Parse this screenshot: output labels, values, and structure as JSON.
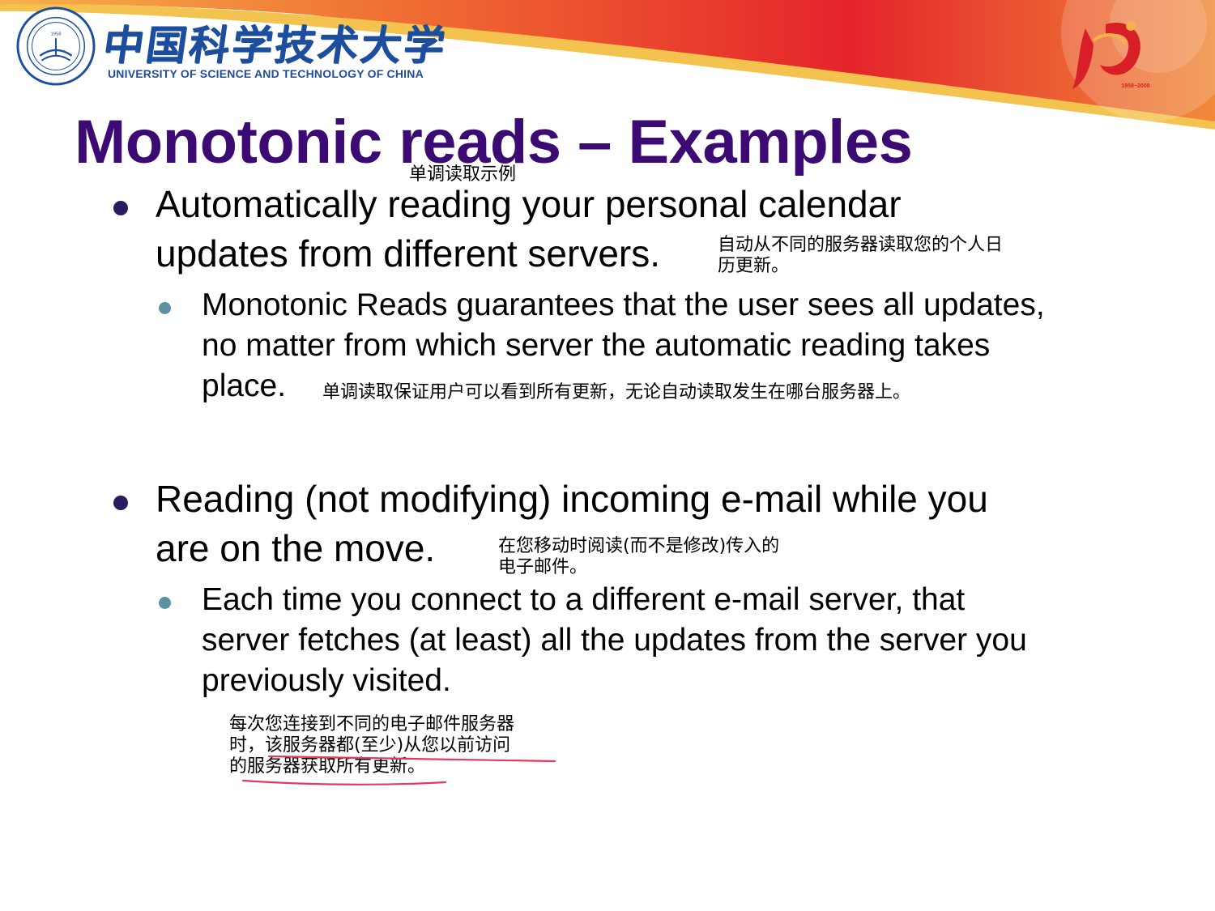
{
  "header": {
    "university_cn": "中国科学技术大学",
    "university_en": "UNIVERSITY OF SCIENCE AND TECHNOLOGY OF CHINA",
    "seal_year": "1958",
    "seal_text": "University of Science and Technology of China",
    "anniversary_years": "1958~2008"
  },
  "slide": {
    "title": "Monotonic reads – Examples",
    "title_note": "单调读取示例",
    "bullets": [
      {
        "lines": [
          "Automatically reading your personal calendar",
          "updates from different servers."
        ],
        "note_lines": [
          "自动从不同的服务器读取您的个人日",
          "历更新。"
        ],
        "sub": {
          "lines": [
            "Monotonic Reads guarantees that the user sees all updates,",
            "no matter from which server the automatic reading takes",
            "place."
          ],
          "note": "单调读取保证用户可以看到所有更新，无论自动读取发生在哪台服务器上。"
        }
      },
      {
        "lines": [
          "Reading (not modifying) incoming e-mail while you",
          "are on the move."
        ],
        "note_lines": [
          "在您移动时阅读(而不是修改)传入的",
          "电子邮件。"
        ],
        "sub": {
          "lines": [
            "Each time you connect to a different e-mail server, that",
            "server fetches (at least) all the updates from the server you",
            "previously visited."
          ],
          "note_lines": [
            "每次您连接到不同的电子邮件服务器",
            "时，该服务器都(至少)从您以前访问",
            "的服务器获取所有更新。"
          ]
        }
      }
    ]
  },
  "colors": {
    "title": "#3c0a73",
    "logo_blue": "#1d4e9e",
    "band_red": "#e5242b",
    "band_orange": "#f4a43a",
    "ink_red": "#e03a5c"
  }
}
